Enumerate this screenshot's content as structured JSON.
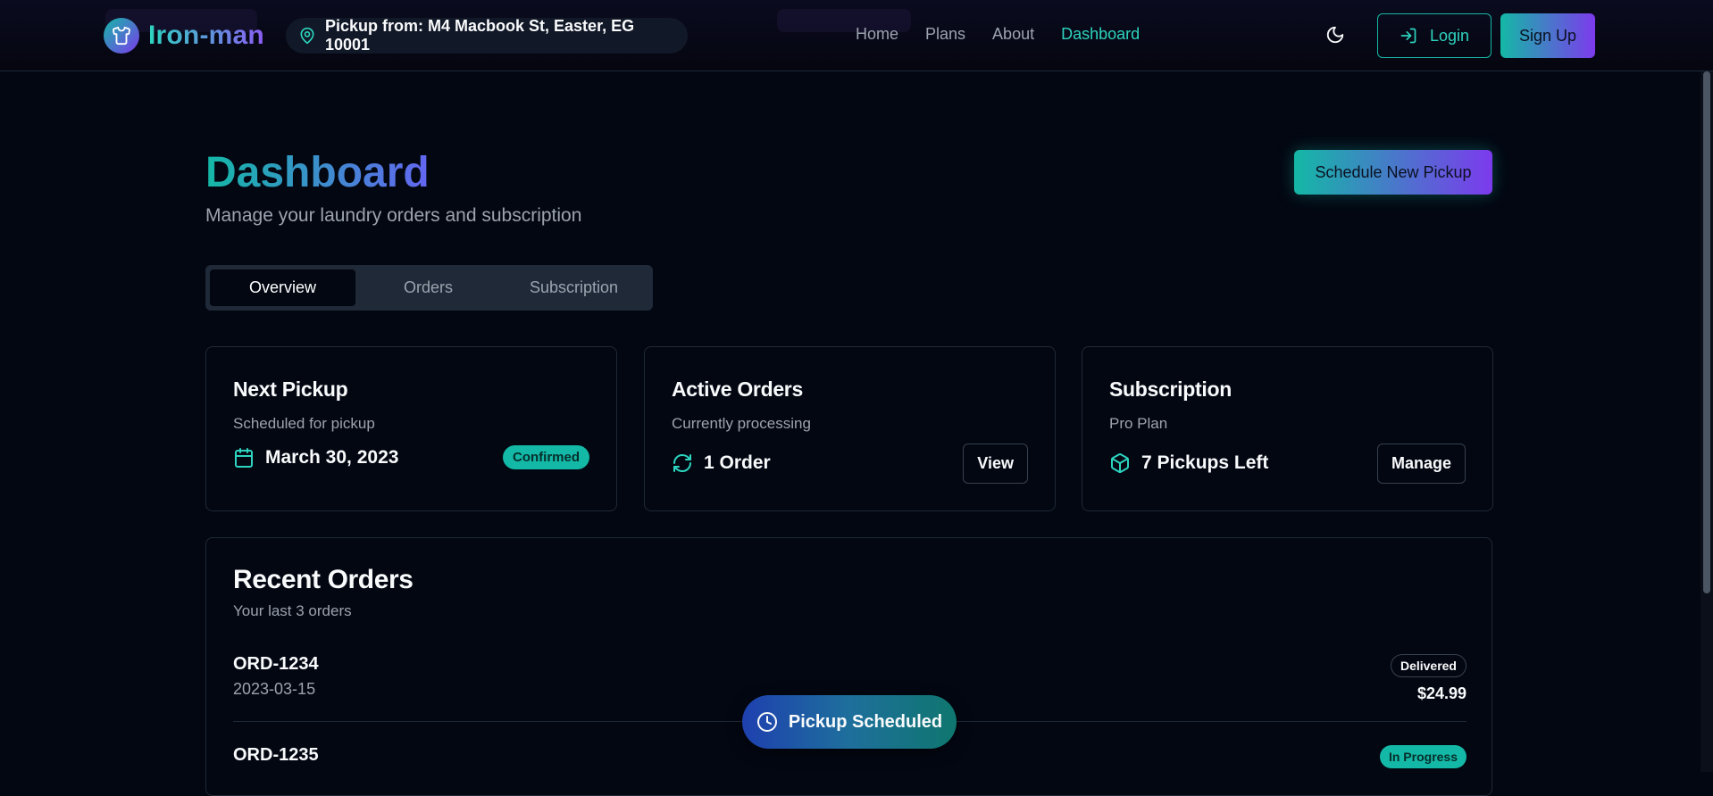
{
  "header": {
    "brand": "Iron-man",
    "pickup": "Pickup from: M4 Macbook St, Easter, EG 10001",
    "nav": [
      {
        "label": "Home"
      },
      {
        "label": "Plans"
      },
      {
        "label": "About"
      },
      {
        "label": "Dashboard"
      }
    ],
    "login_label": "Login",
    "signup_label": "Sign Up"
  },
  "main": {
    "title": "Dashboard",
    "subtitle": "Manage your laundry orders and subscription",
    "schedule_button": "Schedule New Pickup",
    "tabs": [
      {
        "label": "Overview"
      },
      {
        "label": "Orders"
      },
      {
        "label": "Subscription"
      }
    ],
    "cards": {
      "next_pickup": {
        "title": "Next Pickup",
        "desc": "Scheduled for pickup",
        "value": "March 30, 2023",
        "badge": "Confirmed",
        "icon": "calendar-icon"
      },
      "active_orders": {
        "title": "Active Orders",
        "desc": "Currently processing",
        "value": "1 Order",
        "button": "View",
        "icon": "refresh-icon"
      },
      "subscription": {
        "title": "Subscription",
        "desc": "Pro Plan",
        "value": "7 Pickups Left",
        "button": "Manage",
        "icon": "package-icon"
      }
    },
    "recent_orders": {
      "title": "Recent Orders",
      "subtitle": "Your last 3 orders",
      "orders": [
        {
          "id": "ORD-1234",
          "date": "2023-03-15",
          "status": "Delivered",
          "price": "$24.99"
        },
        {
          "id": "ORD-1235",
          "status": "In Progress"
        }
      ]
    }
  },
  "toast": {
    "label": "Pickup Scheduled",
    "icon": "clock-icon"
  },
  "colors": {
    "accent": "#14b8a6",
    "accent2": "#7c3aed",
    "background": "#030712"
  }
}
